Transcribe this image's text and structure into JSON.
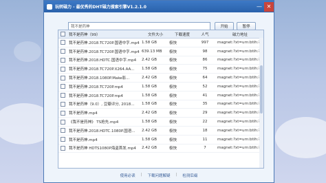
{
  "window": {
    "title": "玩转磁力 - 最优秀的DHT磁力搜索引擎V1.2.1.0",
    "minimize_label": "—",
    "close_label": "✕"
  },
  "search": {
    "value": "我不是药神",
    "start_label": "开始",
    "stop_label": "暂停"
  },
  "table": {
    "headers": {
      "name": "我不是药神（99）",
      "size": "文件大小",
      "speed": "下载速度",
      "popularity": "人气",
      "magnet": "磁力地址"
    },
    "rows": [
      {
        "name": "我不是药神.2018.TC720P.国语中字.mp4",
        "size": "1.58 GB",
        "speed": "极快",
        "popularity": "997",
        "magnet": "magnet:?xt=urn:btih:?"
      },
      {
        "name": "我不是药神.2018.TC720P.国语中字.mp4",
        "size": "639.13 MB",
        "speed": "极快",
        "popularity": "98",
        "magnet": "magnet:?xt=urn:btih:?"
      },
      {
        "name": "我不是药神.2018.HDTC.国语中字.mp4",
        "size": "2.42 GB",
        "speed": "极快",
        "popularity": "86",
        "magnet": "magnet:?xt=urn:btih:?"
      },
      {
        "name": "我不是药神.2018.TC720P.X264.AA...",
        "size": "1.58 GB",
        "speed": "极快",
        "popularity": "75",
        "magnet": "magnet:?xt=urn:btih:?"
      },
      {
        "name": "我不是药神.2018.1080P.Make影...",
        "size": "2.42 GB",
        "speed": "极快",
        "popularity": "64",
        "magnet": "magnet:?xt=urn:btih:?"
      },
      {
        "name": "我不是药神.2018.TC720P.mp4",
        "size": "1.58 GB",
        "speed": "极快",
        "popularity": "52",
        "magnet": "magnet:?xt=urn:btih:?"
      },
      {
        "name": "我不是药神.2018.TC720P.mp4",
        "size": "1.58 GB",
        "speed": "极快",
        "popularity": "41",
        "magnet": "magnet:?xt=urn:btih:?"
      },
      {
        "name": "我不是药神（9.0）, 豆瓣评分, 2018...",
        "size": "1.58 GB",
        "speed": "极快",
        "popularity": "35",
        "magnet": "magnet:?xt=urn:btih:?"
      },
      {
        "name": "我不是药神.mp4",
        "size": "2.42 GB",
        "speed": "极快",
        "popularity": "29",
        "magnet": "magnet:?xt=urn:btih:?"
      },
      {
        "name": "《我不是药神》 TS抢先.mp4",
        "size": "1.58 GB",
        "speed": "极快",
        "popularity": "22",
        "magnet": "magnet:?xt=urn:btih:?"
      },
      {
        "name": "我不是药神.2018.HDTC.1080P.国语...",
        "size": "2.42 GB",
        "speed": "极快",
        "popularity": "18",
        "magnet": "magnet:?xt=urn:btih:?"
      },
      {
        "name": "我不是药神.mp4",
        "size": "1.58 GB",
        "speed": "极快",
        "popularity": "11",
        "magnet": "magnet:?xt=urn:btih:?"
      },
      {
        "name": "我不是药神 HDTS1080P海盗首发.mp4",
        "size": "2.42 GB",
        "speed": "极快",
        "popularity": "7",
        "magnet": "magnet:?xt=urn:btih:?"
      }
    ]
  },
  "footer": {
    "links": [
      "使用必读",
      "下载问题解疑",
      "检测后缀"
    ],
    "separator": "|"
  },
  "colors": {
    "titlebar": "#2a62ab",
    "accent": "#3a5f99",
    "background": "#b9c7e6"
  }
}
